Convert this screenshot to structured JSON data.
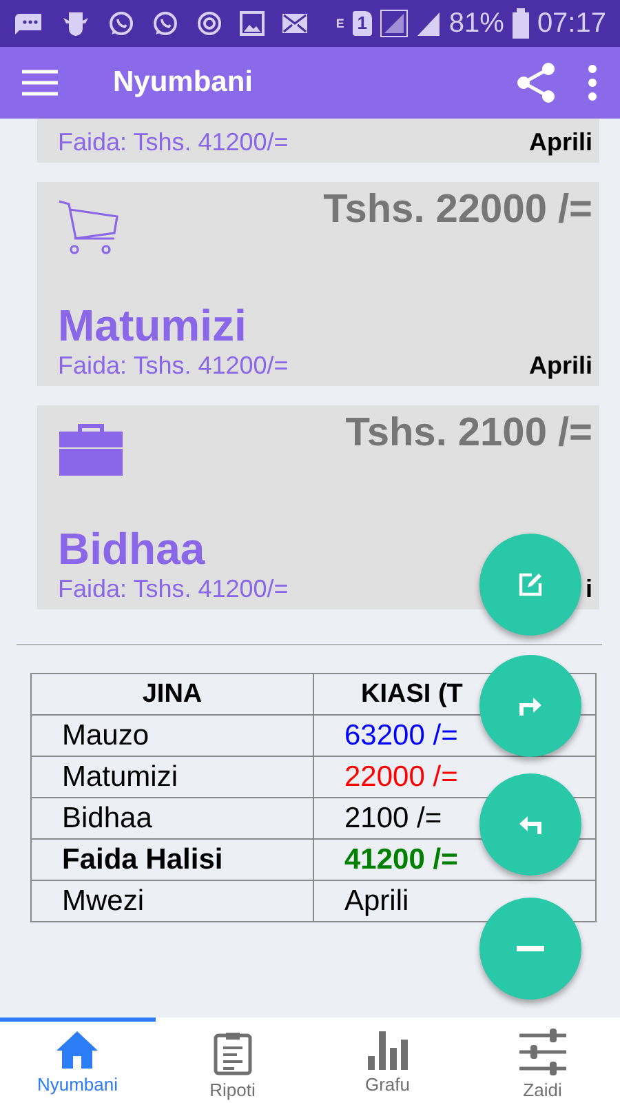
{
  "status_bar": {
    "notifications": [
      {
        "kind": "chat"
      },
      {
        "kind": "mascot"
      },
      {
        "kind": "whatsapp"
      },
      {
        "kind": "whatsapp"
      },
      {
        "kind": "sync"
      },
      {
        "kind": "image"
      },
      {
        "kind": "mail"
      }
    ],
    "network_type": "E",
    "sim": "1",
    "battery": "81%",
    "time": "07:17"
  },
  "app_bar": {
    "title": "Nyumbani"
  },
  "cards": [
    {
      "kind": "partial",
      "profit": "Faida: Tshs. 41200/=",
      "month": "Aprili"
    },
    {
      "kind": "cart",
      "amount": "Tshs. 22000 /=",
      "title": "Matumizi",
      "profit": "Faida: Tshs. 41200/=",
      "month": "Aprili"
    },
    {
      "kind": "briefcase",
      "amount": "Tshs. 2100 /=",
      "title": "Bidhaa",
      "profit": "Faida: Tshs. 41200/=",
      "month": "i"
    }
  ],
  "table": {
    "columns": [
      "JINA",
      "KIASI (T"
    ],
    "rows": [
      {
        "name": "Mauzo",
        "value": "63200 /=",
        "color": "#0000ff",
        "bold": false
      },
      {
        "name": "Matumizi",
        "value": "22000 /=",
        "color": "#ff0000",
        "bold": false
      },
      {
        "name": "Bidhaa",
        "value": "2100 /=",
        "color": "#000000",
        "bold": false
      },
      {
        "name": "Faida Halisi",
        "value": "41200 /=",
        "color": "#008000",
        "bold": true
      },
      {
        "name": "Mwezi",
        "value": "Aprili",
        "color": "#000000",
        "bold": false
      }
    ]
  },
  "fabs": [
    {
      "kind": "edit"
    },
    {
      "kind": "forward"
    },
    {
      "kind": "back"
    },
    {
      "kind": "minus"
    }
  ],
  "bottom_nav": [
    {
      "label": "Nyumbani",
      "kind": "home",
      "selected": true
    },
    {
      "label": "Ripoti",
      "kind": "clipboard",
      "selected": false
    },
    {
      "label": "Grafu",
      "kind": "bars",
      "selected": false
    },
    {
      "label": "Zaidi",
      "kind": "sliders",
      "selected": false
    }
  ]
}
